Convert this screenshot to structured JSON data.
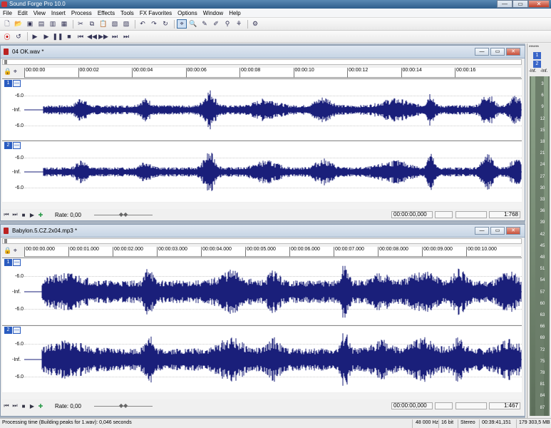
{
  "app": {
    "title": "Sound Forge Pro 10.0"
  },
  "window_buttons": {
    "minimize": "—",
    "maximize": "▭",
    "close": "✕"
  },
  "menu": [
    "File",
    "Edit",
    "View",
    "Insert",
    "Process",
    "Effects",
    "Tools",
    "FX Favorites",
    "Options",
    "Window",
    "Help"
  ],
  "docs": [
    {
      "title": "04 OK.wav *",
      "ruler": [
        "00:00:00",
        "00:00:02",
        "00:00:04",
        "00:00:06",
        "00:00:08",
        "00:00:10",
        "00:00:12",
        "00:00:14",
        "00:00:16"
      ],
      "rate": "Rate: 0,00",
      "pos": "00:00:00,000",
      "zoom": "1:768"
    },
    {
      "title": "Babylon.5.CZ.2x04.mp3 *",
      "ruler": [
        "00:00:00.000",
        "00:00:01.000",
        "00:00:02.000",
        "00:00:03.000",
        "00:00:04.000",
        "00:00:05.000",
        "00:00:06.000",
        "00:00:07.000",
        "00:00:08.000",
        "00:00:09.000",
        "00:00:10.000"
      ],
      "rate": "Rate: 0,00",
      "pos": "00:00:00,000",
      "zoom": "1:467"
    }
  ],
  "channel": {
    "ch1": "1",
    "ch2": "2",
    "db_top": "-6.0",
    "db_mid": "-Inf.",
    "db_bot": "-6.0",
    "mute": "—"
  },
  "meter": {
    "header": "******",
    "ch1": "1",
    "ch2": "2",
    "inf_l": "-Inf.",
    "inf_r": "-Inf.",
    "scale": [
      "3",
      "6",
      "9",
      "12",
      "15",
      "18",
      "21",
      "24",
      "27",
      "30",
      "33",
      "36",
      "39",
      "42",
      "45",
      "48",
      "51",
      "54",
      "57",
      "60",
      "63",
      "66",
      "69",
      "72",
      "75",
      "78",
      "81",
      "84",
      "87"
    ]
  },
  "status": {
    "message": "Processing time (Building peaks for 1.wav): 0,046 seconds",
    "rate": "48 000 Hz",
    "bits": "16 bit",
    "mode": "Stereo",
    "length": "00:39:41,151",
    "size": "179 303,5 MB"
  },
  "colors": {
    "wave": "#1a1f7a",
    "channel_label": "#2a5cc0"
  }
}
